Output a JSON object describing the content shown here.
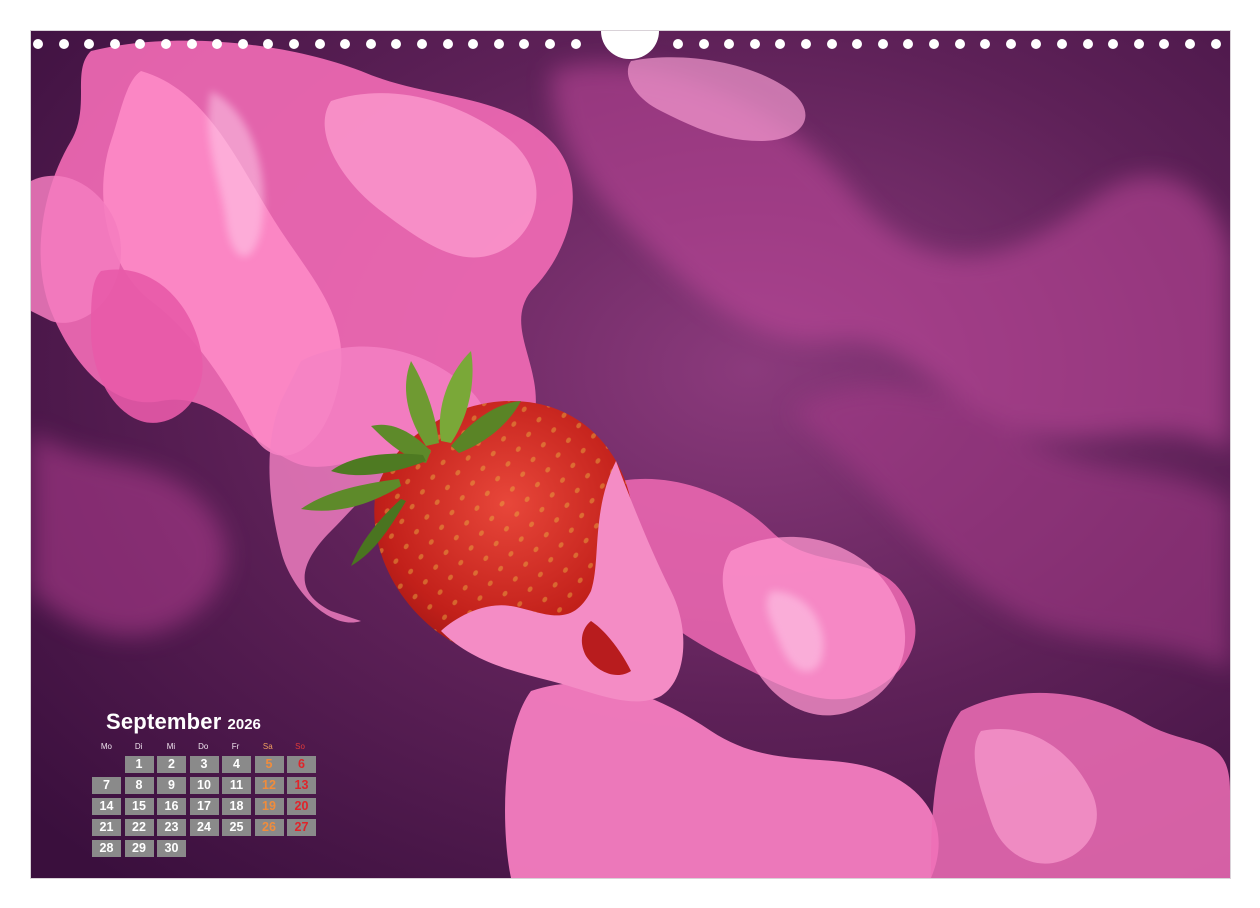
{
  "calendar": {
    "month": "September",
    "year": "2026",
    "weekdays": [
      "Mo",
      "Di",
      "Mi",
      "Do",
      "Fr",
      "Sa",
      "So"
    ],
    "leading_blanks": 1,
    "days": [
      "1",
      "2",
      "3",
      "4",
      "5",
      "6",
      "7",
      "8",
      "9",
      "10",
      "11",
      "12",
      "13",
      "14",
      "15",
      "16",
      "17",
      "18",
      "19",
      "20",
      "21",
      "22",
      "23",
      "24",
      "25",
      "26",
      "27",
      "28",
      "29",
      "30"
    ]
  },
  "colors": {
    "background_purple": "#5b1f55",
    "smoke_pink": "#f06ab4",
    "strawberry_red": "#c8231c",
    "leaf_green": "#5e8a2a",
    "day_cell_gray": "#8a8a8a",
    "saturday_orange": "#f08c3c",
    "sunday_red": "#e0242a"
  },
  "photo": {
    "subject_icon": "strawberry-icon"
  }
}
